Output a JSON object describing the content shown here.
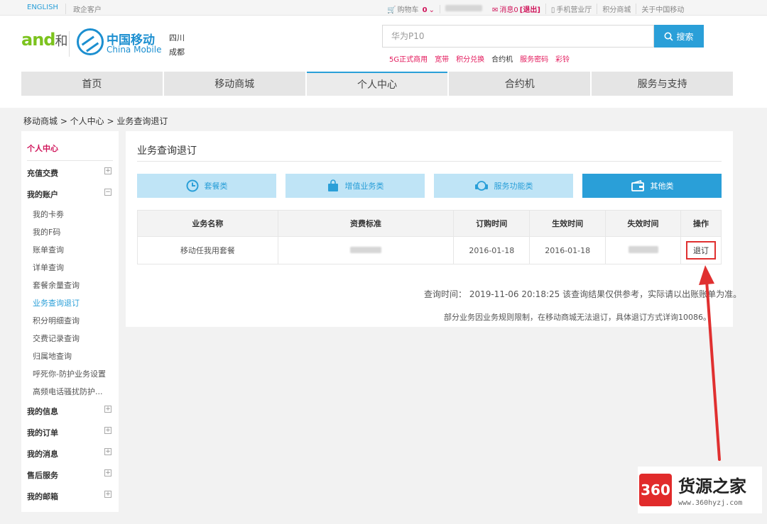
{
  "topbar": {
    "english": "ENGLISH",
    "gov": "政企客户",
    "cart": "购物车",
    "cart_count": "0",
    "msg": "消息0",
    "logout": "[退出]",
    "mobile_hall": "手机营业厅",
    "points_mall": "积分商城",
    "about": "关于中国移动"
  },
  "header": {
    "and_logo": "and",
    "he": "和",
    "cm_cn": "中国移动",
    "cm_en": "China Mobile",
    "province": "四川",
    "city": "成都"
  },
  "search": {
    "placeholder": "华为P10",
    "button": "搜索"
  },
  "hotwords": [
    "5G正式商用",
    "宽带",
    "积分兑换",
    "合约机",
    "服务密码",
    "彩铃"
  ],
  "nav": [
    "首页",
    "移动商城",
    "个人中心",
    "合约机",
    "服务与支持"
  ],
  "breadcrumb": "移动商城 > 个人中心 > 业务查询退订",
  "sidebar": {
    "title": "个人中心",
    "recharge": "充值交费",
    "account": "我的账户",
    "sub": [
      "我的卡劵",
      "我的F码",
      "账单查询",
      "详单查询",
      "套餐余量查询",
      "业务查询退订",
      "积分明细查询",
      "交费记录查询",
      "归属地查询",
      "呼死你-防护业务设置",
      "高频电话骚扰防护..."
    ],
    "info": "我的信息",
    "orders": "我的订单",
    "messages": "我的消息",
    "aftersale": "售后服务",
    "mailbox": "我的邮箱"
  },
  "main": {
    "title": "业务查询退订",
    "categories": [
      "套餐类",
      "增值业务类",
      "服务功能类",
      "其他类"
    ],
    "table": {
      "headers": [
        "业务名称",
        "资费标准",
        "订购时间",
        "生效时间",
        "失效时间",
        "操作"
      ],
      "row": {
        "name": "移动任我用套餐",
        "order_time": "2016-01-18",
        "effective_time": "2016-01-18",
        "action": "退订"
      }
    },
    "note1": "查询时间：  2019-11-06 20:18:25 该查询结果仅供参考，实际请以出账账单为准。",
    "note2": "部分业务因业务规则限制，在移动商城无法退订，具体退订方式详询10086。"
  },
  "watermark": {
    "badge": "360",
    "title": "货源之家",
    "url": "www.360hyzj.com"
  },
  "colors": {
    "accent": "#2a9fd8",
    "brand_red": "#d0145a",
    "arrow_red": "#e03030"
  }
}
